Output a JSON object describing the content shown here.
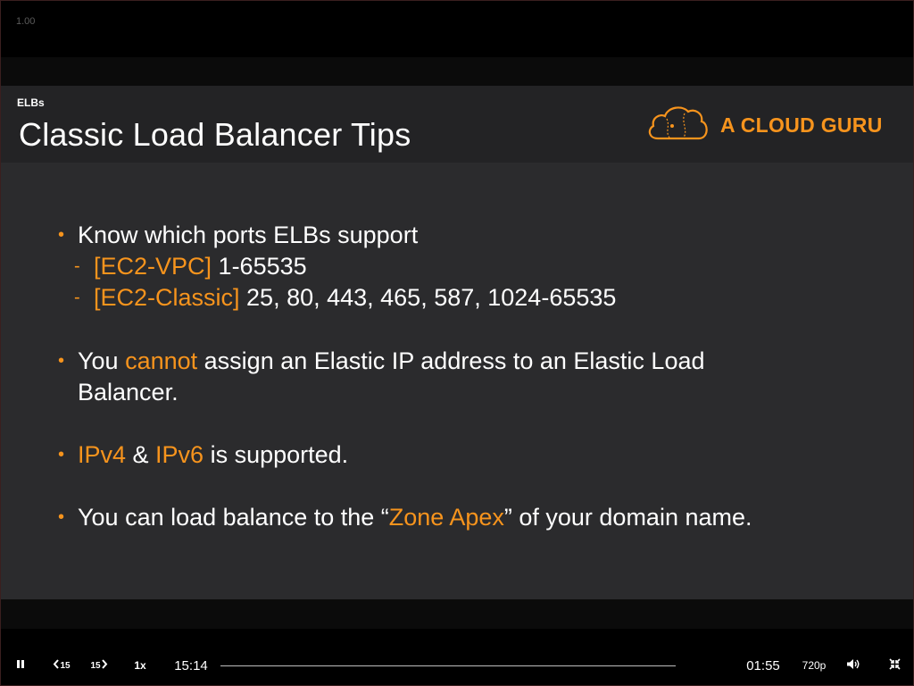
{
  "player": {
    "zoom_label": "1.00",
    "elapsed": "15:14",
    "remaining": "01:55",
    "quality": "720p",
    "speed": "1x",
    "back_label": "15",
    "forward_label": "15",
    "progress_fraction": 0.0,
    "icons": {
      "pause": "pause-icon",
      "rewind": "rewind-15-icon",
      "forward": "forward-15-icon",
      "volume": "volume-icon",
      "exit_fullscreen": "exit-fullscreen-icon"
    }
  },
  "slide": {
    "section": "ELBs",
    "title": "Classic Load Balancer Tips",
    "brand": "A CLOUD GURU",
    "brand_icon": "cloud-logo-icon",
    "accent_color": "#f7941d",
    "bullets": [
      {
        "text": "Know which ports ELBs support",
        "subs": [
          {
            "label": "[EC2-VPC]",
            "value": " 1-65535"
          },
          {
            "label": "[EC2-Classic]",
            "value": " 25, 80, 443, 465, 587, 1024-65535"
          }
        ]
      },
      {
        "pre": "You ",
        "highlight": "cannot",
        "post": " assign an Elastic IP address to an Elastic Load",
        "line2": "Balancer."
      },
      {
        "hl1": "IPv4",
        "mid": " & ",
        "hl2": "IPv6",
        "post": " is supported."
      },
      {
        "pre": "You can load balance to the “",
        "highlight": "Zone Apex",
        "post": "” of your domain name."
      }
    ]
  }
}
